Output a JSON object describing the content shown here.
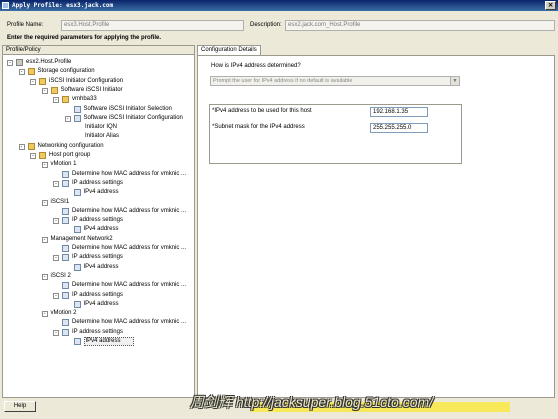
{
  "window": {
    "title": "Apply Profile: esx3.jack.com",
    "close_label": "×"
  },
  "header": {
    "profile_name_label": "Profile Name:",
    "profile_name_value": "esx3.Host.Profile",
    "description_label": "Description:",
    "description_value": "esx2.jack.com_Host.Profile",
    "instruction": "Enter the required parameters for applying the profile."
  },
  "left_pane": {
    "header": "Profile/Policy",
    "tree": [
      {
        "label": "esx2.Host.Profile",
        "depth": 0,
        "expander": "-",
        "icon": "profile"
      },
      {
        "label": "Storage configuration",
        "depth": 1,
        "expander": "-",
        "icon": "folder"
      },
      {
        "label": "iSCSI Initiator Configuration",
        "depth": 2,
        "expander": "-",
        "icon": "folder"
      },
      {
        "label": "Software iSCSI Initiator",
        "depth": 3,
        "expander": "-",
        "icon": "folder"
      },
      {
        "label": "vmhba33",
        "depth": 4,
        "expander": "-",
        "icon": "folder"
      },
      {
        "label": "Software iSCSI Initiator Selection",
        "depth": 5,
        "expander": "",
        "icon": "prop"
      },
      {
        "label": "Software iSCSI Initiator Configuration",
        "depth": 5,
        "expander": "-",
        "icon": "prop"
      },
      {
        "label": "Initiator IQN",
        "depth": 6,
        "expander": "",
        "icon": ""
      },
      {
        "label": "Initiator Alias",
        "depth": 6,
        "expander": "",
        "icon": ""
      },
      {
        "label": "Networking configuration",
        "depth": 1,
        "expander": "-",
        "icon": "folder"
      },
      {
        "label": "Host port group",
        "depth": 2,
        "expander": "-",
        "icon": "folder"
      },
      {
        "label": "vMotion 1",
        "depth": 3,
        "expander": "-",
        "icon": ""
      },
      {
        "label": "Determine how MAC address for vmknic ...",
        "depth": 4,
        "expander": "",
        "icon": "prop"
      },
      {
        "label": "IP address settings",
        "depth": 4,
        "expander": "-",
        "icon": "prop"
      },
      {
        "label": "IPv4 address",
        "depth": 5,
        "expander": "",
        "icon": "prop"
      },
      {
        "label": "iSCSI1",
        "depth": 3,
        "expander": "-",
        "icon": ""
      },
      {
        "label": "Determine how MAC address for vmknic ...",
        "depth": 4,
        "expander": "",
        "icon": "prop"
      },
      {
        "label": "IP address settings",
        "depth": 4,
        "expander": "-",
        "icon": "prop"
      },
      {
        "label": "IPv4 address",
        "depth": 5,
        "expander": "",
        "icon": "prop"
      },
      {
        "label": "Management Network2",
        "depth": 3,
        "expander": "-",
        "icon": ""
      },
      {
        "label": "Determine how MAC address for vmknic ...",
        "depth": 4,
        "expander": "",
        "icon": "prop"
      },
      {
        "label": "IP address settings",
        "depth": 4,
        "expander": "-",
        "icon": "prop"
      },
      {
        "label": "IPv4 address",
        "depth": 5,
        "expander": "",
        "icon": "prop"
      },
      {
        "label": "iSCSI 2",
        "depth": 3,
        "expander": "-",
        "icon": ""
      },
      {
        "label": "Determine how MAC address for vmknic ...",
        "depth": 4,
        "expander": "",
        "icon": "prop"
      },
      {
        "label": "IP address settings",
        "depth": 4,
        "expander": "-",
        "icon": "prop"
      },
      {
        "label": "IPv4 address",
        "depth": 5,
        "expander": "",
        "icon": "prop"
      },
      {
        "label": "vMotion 2",
        "depth": 3,
        "expander": "-",
        "icon": ""
      },
      {
        "label": "Determine how MAC address for vmknic ...",
        "depth": 4,
        "expander": "",
        "icon": "prop"
      },
      {
        "label": "IP address settings",
        "depth": 4,
        "expander": "-",
        "icon": "prop"
      },
      {
        "label": "IPv4 address",
        "depth": 5,
        "expander": "",
        "icon": "prop",
        "selected": true
      }
    ]
  },
  "right_pane": {
    "tab_label": "Configuration Details",
    "question": "How is IPv4 address determined?",
    "dropdown_value": "Prompt the user for IPv4 address if no default is available",
    "ipv4_label": "*IPv4 address to be used for this host",
    "ipv4_value": "192.168.1.35",
    "subnet_label": "*Subnet mask for the IPv4 address",
    "subnet_value": "255.255.255.0"
  },
  "footer": {
    "help_label": "Help",
    "watermark": "周剑辉 http://jacksuper.blog.51cto.com/"
  }
}
